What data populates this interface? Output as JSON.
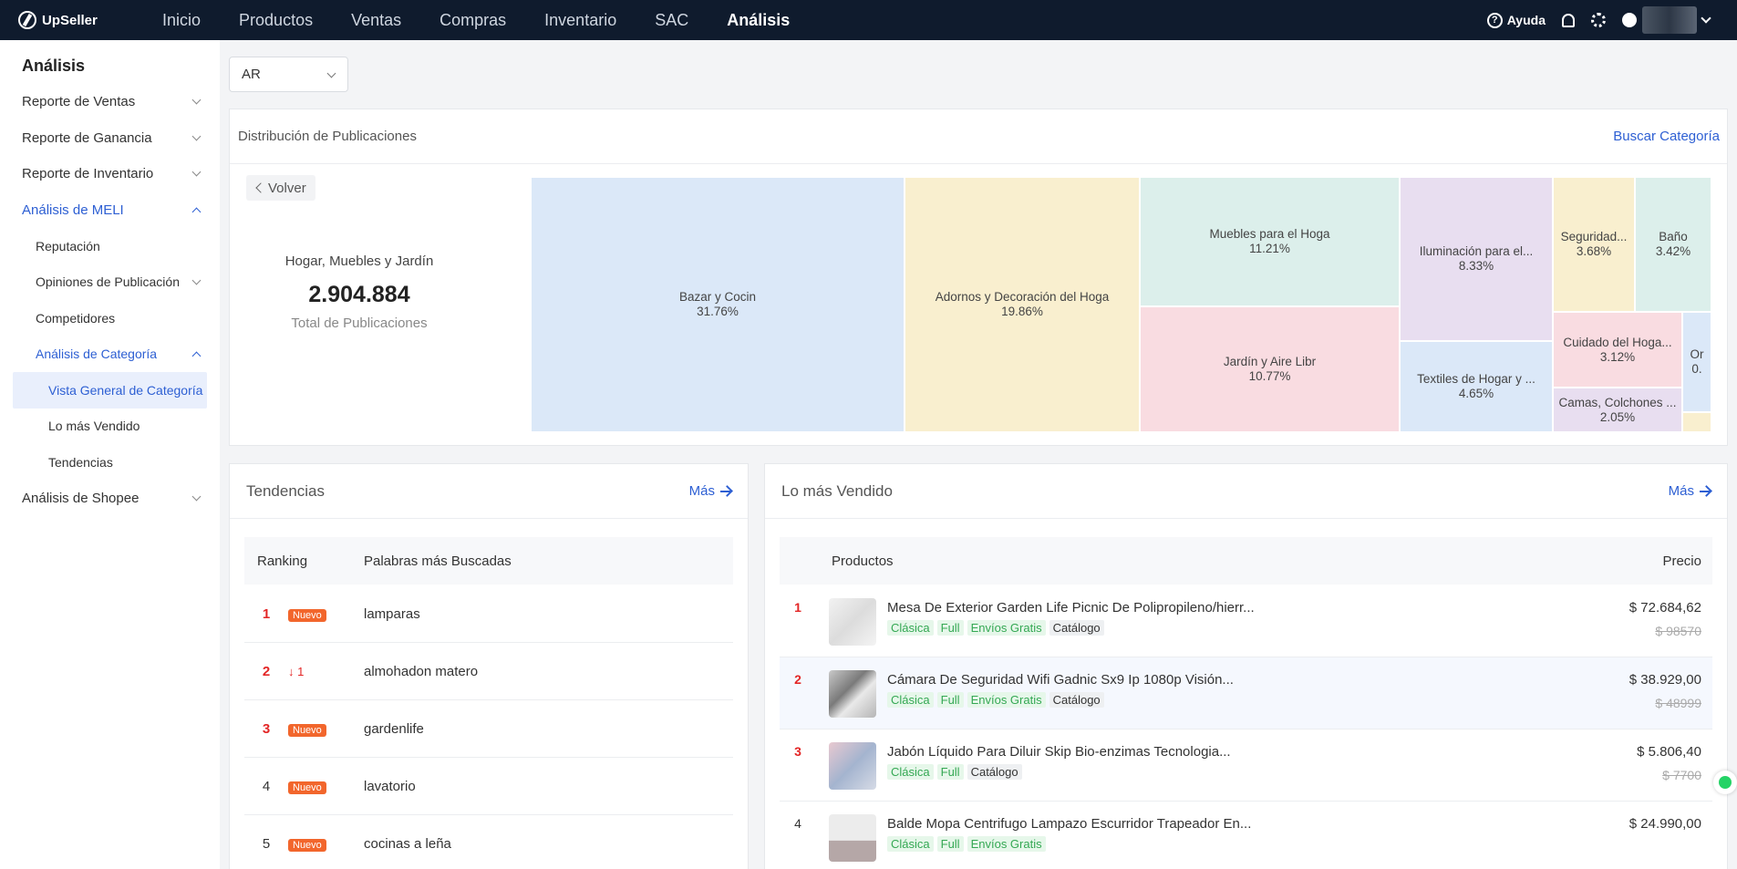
{
  "topbar": {
    "brand": "UpSeller",
    "nav": [
      "Inicio",
      "Productos",
      "Ventas",
      "Compras",
      "Inventario",
      "SAC",
      "Análisis"
    ],
    "active_nav": "Análisis",
    "help": "Ayuda"
  },
  "sidebar": {
    "title": "Análisis",
    "items": [
      {
        "label": "Reporte de Ventas"
      },
      {
        "label": "Reporte de Ganancia"
      },
      {
        "label": "Reporte de Inventario"
      },
      {
        "label": "Análisis de MELI"
      },
      {
        "label": "Reputación"
      },
      {
        "label": "Opiniones de Publicación"
      },
      {
        "label": "Competidores"
      },
      {
        "label": "Análisis de Categoría"
      },
      {
        "label": "Vista General de Categoría"
      },
      {
        "label": "Lo más Vendido"
      },
      {
        "label": "Tendencias"
      },
      {
        "label": "Análisis de Shopee"
      }
    ]
  },
  "country_select": {
    "value": "AR"
  },
  "distribution": {
    "title": "Distribución de Publicaciones",
    "search_link": "Buscar Categoría",
    "back": "Volver",
    "category": "Hogar, Muebles y Jardín",
    "total": "2.904.884",
    "total_label": "Total de Publicaciones",
    "tiles": [
      {
        "name": "Bazar y Cocin",
        "pct": "31.76%",
        "color": "#dbe8f8"
      },
      {
        "name": "Adornos y Decoración del Hoga",
        "pct": "19.86%",
        "color": "#f9efcf"
      },
      {
        "name": "Muebles para el Hoga",
        "pct": "11.21%",
        "color": "#dcefeb"
      },
      {
        "name": "Jardín y Aire Libr",
        "pct": "10.77%",
        "color": "#f9dce1"
      },
      {
        "name": "Iluminación para el...",
        "pct": "8.33%",
        "color": "#e8def0"
      },
      {
        "name": "Textiles de Hogar y ...",
        "pct": "4.65%",
        "color": "#dbe8f8"
      },
      {
        "name": "Seguridad...",
        "pct": "3.68%",
        "color": "#f9efcf"
      },
      {
        "name": "Baño",
        "pct": "3.42%",
        "color": "#dcefeb"
      },
      {
        "name": "Cuidado del Hoga...",
        "pct": "3.12%",
        "color": "#f9dce1"
      },
      {
        "name": "Camas, Colchones ...",
        "pct": "2.05%",
        "color": "#e8def0"
      },
      {
        "name": "Or",
        "pct": "0.",
        "color": "#dbe8f8"
      },
      {
        "name": "",
        "pct": "",
        "color": "#f9efcf"
      }
    ]
  },
  "trends": {
    "title": "Tendencias",
    "more": "Más",
    "col_rank": "Ranking",
    "col_words": "Palabras más Buscadas",
    "rows": [
      {
        "rank": "1",
        "badge": "Nuevo",
        "change": "",
        "word": "lamparas",
        "highlight": true
      },
      {
        "rank": "2",
        "badge": "",
        "change": "↓ 1",
        "word": "almohadon matero",
        "highlight": true
      },
      {
        "rank": "3",
        "badge": "Nuevo",
        "change": "",
        "word": "gardenlife",
        "highlight": true
      },
      {
        "rank": "4",
        "badge": "Nuevo",
        "change": "",
        "word": "lavatorio",
        "highlight": false
      },
      {
        "rank": "5",
        "badge": "Nuevo",
        "change": "",
        "word": "cocinas a leña",
        "highlight": false
      }
    ]
  },
  "best": {
    "title": "Lo más Vendido",
    "more": "Más",
    "col_products": "Productos",
    "col_price": "Precio",
    "rows": [
      {
        "rank": "1",
        "name": "Mesa De Exterior Garden Life Picnic De Polipropileno/hierr...",
        "tags": [
          "Clásica",
          "Full",
          "Envíos Gratis",
          "Catálogo"
        ],
        "price": "$ 72.684,62",
        "old": "$ 98570"
      },
      {
        "rank": "2",
        "name": "Cámara De Seguridad Wifi Gadnic Sx9 Ip 1080p Visión...",
        "tags": [
          "Clásica",
          "Full",
          "Envíos Gratis",
          "Catálogo"
        ],
        "price": "$ 38.929,00",
        "old": "$ 48999"
      },
      {
        "rank": "3",
        "name": "Jabón Líquido Para Diluir Skip Bio-enzimas Tecnologia...",
        "tags": [
          "Clásica",
          "Full",
          "Catálogo"
        ],
        "price": "$ 5.806,40",
        "old": "$ 7700"
      },
      {
        "rank": "4",
        "name": "Balde Mopa Centrifugo Lampazo Escurridor Trapeador En...",
        "tags": [
          "Clásica",
          "Full",
          "Envíos Gratis"
        ],
        "price": "$ 24.990,00",
        "old": ""
      }
    ]
  }
}
